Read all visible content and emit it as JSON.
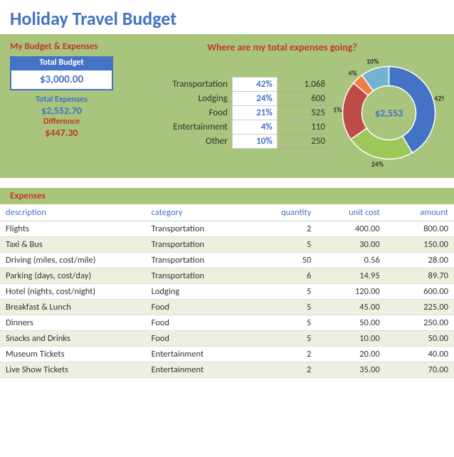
{
  "title": "Holiday Travel Budget",
  "summary": {
    "heading": "My Budget & Expenses",
    "total_budget_label": "Total Budget",
    "total_budget_value": "$3,000.00",
    "total_expenses_label": "Total Expenses",
    "total_expenses_value": "$2,552.70",
    "difference_label": "Difference",
    "difference_value": "$447.30",
    "chart_heading": "Where are my total expenses going?",
    "chart_center": "$2,553",
    "categories": [
      {
        "name": "Transportation",
        "pct": "42%",
        "amt": "1,068",
        "color": "#4472C4",
        "value": 42
      },
      {
        "name": "Lodging",
        "pct": "24%",
        "amt": "600",
        "color": "#9DC759",
        "value": 24
      },
      {
        "name": "Food",
        "pct": "21%",
        "amt": "525",
        "color": "#BE4B48",
        "value": 21
      },
      {
        "name": "Entertainment",
        "pct": "4%",
        "amt": "110",
        "color": "#F07E42",
        "value": 4
      },
      {
        "name": "Other",
        "pct": "10%",
        "amt": "250",
        "color": "#71B3D1",
        "value": 10
      }
    ]
  },
  "expenses": {
    "section_label": "Expenses",
    "columns": [
      "description",
      "category",
      "quantity",
      "unit cost",
      "amount"
    ],
    "rows": [
      {
        "description": "Flights",
        "category": "Transportation",
        "quantity": "2",
        "unit_cost": "400.00",
        "amount": "800.00"
      },
      {
        "description": "Taxi & Bus",
        "category": "Transportation",
        "quantity": "5",
        "unit_cost": "30.00",
        "amount": "150.00"
      },
      {
        "description": "Driving (miles, cost/mile)",
        "category": "Transportation",
        "quantity": "50",
        "unit_cost": "0.56",
        "amount": "28.00"
      },
      {
        "description": "Parking (days, cost/day)",
        "category": "Transportation",
        "quantity": "6",
        "unit_cost": "14.95",
        "amount": "89.70"
      },
      {
        "description": "Hotel (nights, cost/night)",
        "category": "Lodging",
        "quantity": "5",
        "unit_cost": "120.00",
        "amount": "600.00"
      },
      {
        "description": "Breakfast & Lunch",
        "category": "Food",
        "quantity": "5",
        "unit_cost": "45.00",
        "amount": "225.00"
      },
      {
        "description": "Dinners",
        "category": "Food",
        "quantity": "5",
        "unit_cost": "50.00",
        "amount": "250.00"
      },
      {
        "description": "Snacks and Drinks",
        "category": "Food",
        "quantity": "5",
        "unit_cost": "10.00",
        "amount": "50.00"
      },
      {
        "description": "Museum Tickets",
        "category": "Entertainment",
        "quantity": "2",
        "unit_cost": "20.00",
        "amount": "40.00"
      },
      {
        "description": "Live Show Tickets",
        "category": "Entertainment",
        "quantity": "2",
        "unit_cost": "35.00",
        "amount": "70.00"
      }
    ]
  }
}
